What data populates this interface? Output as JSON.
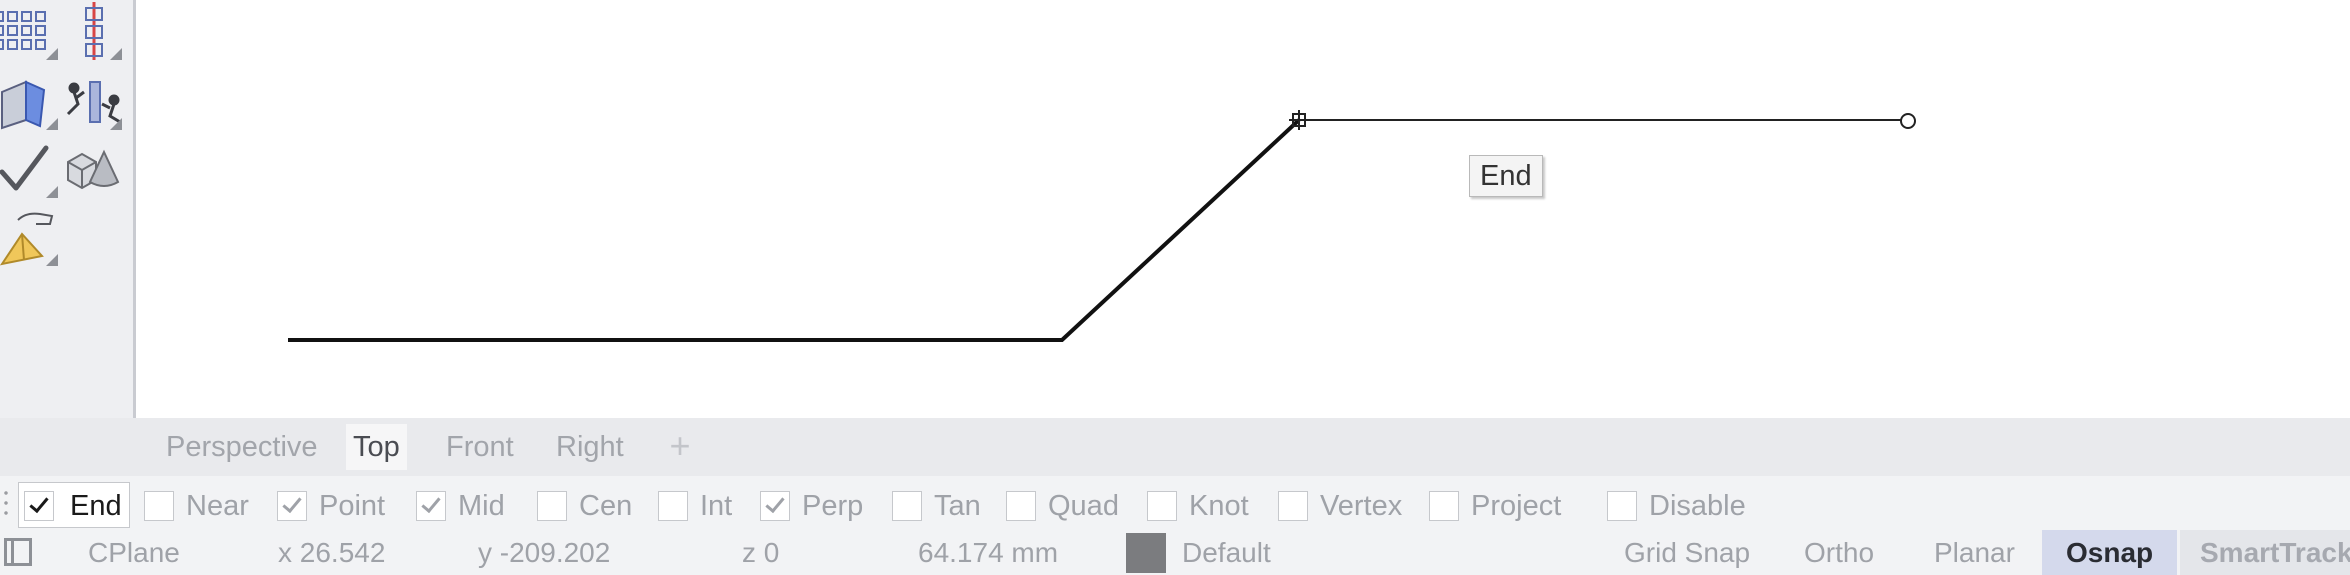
{
  "toolbar": {
    "buttons": [
      {
        "icon": "grid-array-icon"
      },
      {
        "icon": "linear-array-icon"
      },
      {
        "icon": "surface-panels-icon"
      },
      {
        "icon": "gumball-pose-icon"
      },
      {
        "icon": "check-mark-icon"
      },
      {
        "icon": "solid-primitives-icon"
      },
      {
        "icon": "pyramid-hand-icon"
      }
    ]
  },
  "viewport": {
    "snap_tooltip": "End"
  },
  "viewport_tabs": {
    "tabs": [
      {
        "label": "Perspective",
        "active": false
      },
      {
        "label": "Top",
        "active": true
      },
      {
        "label": "Front",
        "active": false
      },
      {
        "label": "Right",
        "active": false
      }
    ],
    "add_label": "+"
  },
  "osnap": {
    "items": [
      {
        "label": "End",
        "checked": true
      },
      {
        "label": "Near",
        "checked": false
      },
      {
        "label": "Point",
        "checked": true
      },
      {
        "label": "Mid",
        "checked": true
      },
      {
        "label": "Cen",
        "checked": false
      },
      {
        "label": "Int",
        "checked": false
      },
      {
        "label": "Perp",
        "checked": true
      },
      {
        "label": "Tan",
        "checked": false
      },
      {
        "label": "Quad",
        "checked": false
      },
      {
        "label": "Knot",
        "checked": false
      },
      {
        "label": "Vertex",
        "checked": false
      },
      {
        "label": "Project",
        "checked": false
      },
      {
        "label": "Disable",
        "checked": false
      }
    ]
  },
  "status": {
    "cplane": "CPlane",
    "x": "x 26.542",
    "y": "y -209.202",
    "z": "z 0",
    "distance": "64.174 mm",
    "layer_color": "#7b7c7f",
    "layer": "Default",
    "grid_snap": "Grid Snap",
    "ortho": "Ortho",
    "planar": "Planar",
    "osnap": "Osnap",
    "smarttrack": "SmartTrack"
  },
  "colors": {
    "accent_active": "#d4d9ec",
    "toolbar_bg": "#eeeff2"
  }
}
